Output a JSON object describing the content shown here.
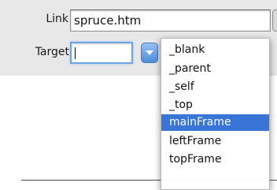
{
  "form": {
    "link_label": "Link",
    "link_value": "spruce.htm",
    "target_label": "Target",
    "target_value": ""
  },
  "target_menu": {
    "items": [
      {
        "label": "_blank",
        "selected": false
      },
      {
        "label": "_parent",
        "selected": false
      },
      {
        "label": "_self",
        "selected": false
      },
      {
        "label": "_top",
        "selected": false
      },
      {
        "label": "mainFrame",
        "selected": true
      },
      {
        "label": "leftFrame",
        "selected": false
      },
      {
        "label": "topFrame",
        "selected": false
      }
    ],
    "selected_color": "#3875d7"
  },
  "icons": {
    "dropdown_toggle": "chevron-down-icon"
  }
}
